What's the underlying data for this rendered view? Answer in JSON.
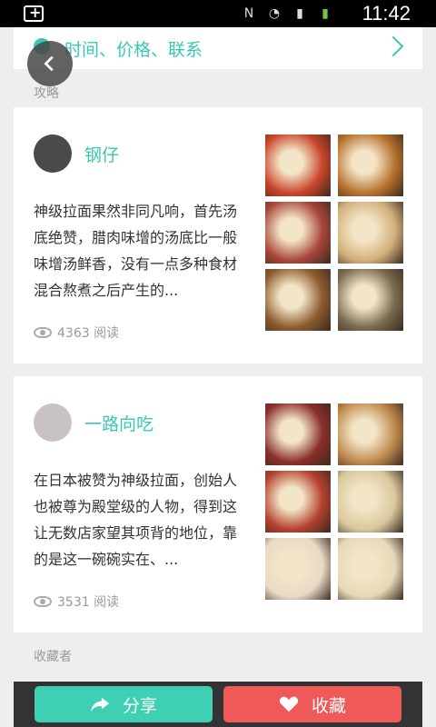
{
  "status_bar": {
    "time": "11:42"
  },
  "top_link": {
    "label": "时间、价格、联系"
  },
  "section_guides": {
    "title": "攻略"
  },
  "posts": [
    {
      "author": "钢仔",
      "excerpt": "神级拉面果然非同凡响，首先汤底绝赞，腊肉味增的汤底比一般味增汤鲜香，没有一点多种食材混合熬煮之后产生的...",
      "reads": "4363 阅读",
      "images": [
        "#c9452a",
        "#b7722e",
        "#a8463a",
        "#d2b07a",
        "#8c5b2f",
        "#7a6a4d"
      ]
    },
    {
      "author": "一路向吃",
      "excerpt": "在日本被赞为神级拉面，创始人也被尊为殿堂级的人物，得到这让无数店家望其项背的地位，靠的是这一碗碗实在、...",
      "reads": "3531 阅读",
      "images": [
        "#8a2e2a",
        "#c08a4e",
        "#b4412e",
        "#d9c89d",
        "#e8dac4",
        "#e6d9b8"
      ]
    }
  ],
  "section_collectors": {
    "title": "收藏者"
  },
  "actions": {
    "share_label": "分享",
    "favorite_label": "收藏"
  },
  "colors": {
    "accent": "#3ac6b4",
    "share": "#3fd0b3",
    "favorite": "#ef5a58"
  }
}
